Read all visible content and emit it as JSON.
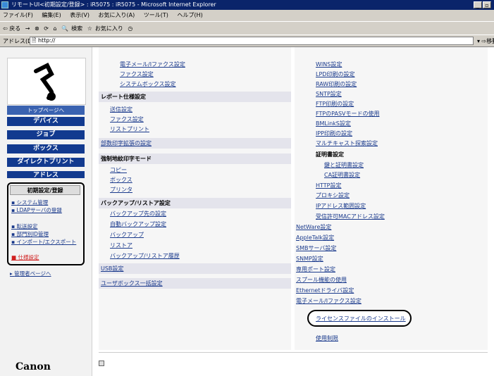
{
  "window": {
    "title": "リモートUI<初期設定/登録> : iR5075 : iR5075 - Microsoft Internet Explorer"
  },
  "menubar": [
    "ファイル(F)",
    "編集(E)",
    "表示(V)",
    "お気に入り(A)",
    "ツール(T)",
    "ヘルプ(H)"
  ],
  "toolbar": {
    "back": "⇦ 戻る",
    "search": "検索",
    "favorites": "お気に入り"
  },
  "address": {
    "label": "アドレス(D)",
    "value": "http://",
    "go": "移動"
  },
  "sidebar": {
    "top_page": "トップページへ",
    "device": "デバイス",
    "job": "ジョブ",
    "box": "ボックス",
    "direct_print": "ダイレクトプリント",
    "address": "アドレス",
    "setup_title": "初期設定/登録",
    "links": [
      "システム管理",
      "LDAPサーバの登録",
      "転送設定",
      "部門別ID管理",
      "インポート/エクスポート",
      "仕様設定"
    ],
    "admin": "管理者ページへ",
    "brand": "Canon"
  },
  "middle": {
    "sec0_items": [
      "電子メール/Iファクス設定",
      "ファクス設定",
      "システムボックス設定"
    ],
    "sec1_title": "レポート仕様設定",
    "sec1_items": [
      "送信設定",
      "ファクス設定",
      "リストプリント"
    ],
    "sec2_title": "部数印字拡張の設定",
    "sec3_title": "強制地紋印字モード",
    "sec3_items": [
      "コピー",
      "ボックス",
      "プリンタ"
    ],
    "sec4_title": "バックアップ/リストア設定",
    "sec4_items": [
      "バックアップ先の設定",
      "自動バックアップ設定",
      "バックアップ",
      "リストア",
      "バックアップ/リストア履歴"
    ],
    "sec5_title": "USB設定",
    "sec6_title": "ユーザボックス一括設定"
  },
  "right": {
    "items_top": [
      "WINS設定",
      "LPD印刷の設定",
      "RAW印刷の設定",
      "SNTP設定",
      "FTP印刷の設定",
      "FTPのPASVモードの使用",
      "BMLinkS設定",
      "IPP印刷の設定",
      "マルチキャスト探索設定"
    ],
    "cert_title": "証明書設定",
    "cert_items": [
      "鍵と証明書設定",
      "CA証明書設定"
    ],
    "items_mid": [
      "HTTP設定",
      "プロキシ設定",
      "IPアドレス範囲設定",
      "受信許可MACアドレス設定"
    ],
    "items_bottom": [
      "NetWare設定",
      "AppleTalk設定",
      "SMBサーバ設定",
      "SNMP設定",
      "専用ポート設定",
      "スプール機能の使用",
      "Ethernetドライバ設定",
      "電子メール/Iファクス設定"
    ],
    "license": "ライセンスファイルのインストール",
    "usage": "使用制限"
  }
}
